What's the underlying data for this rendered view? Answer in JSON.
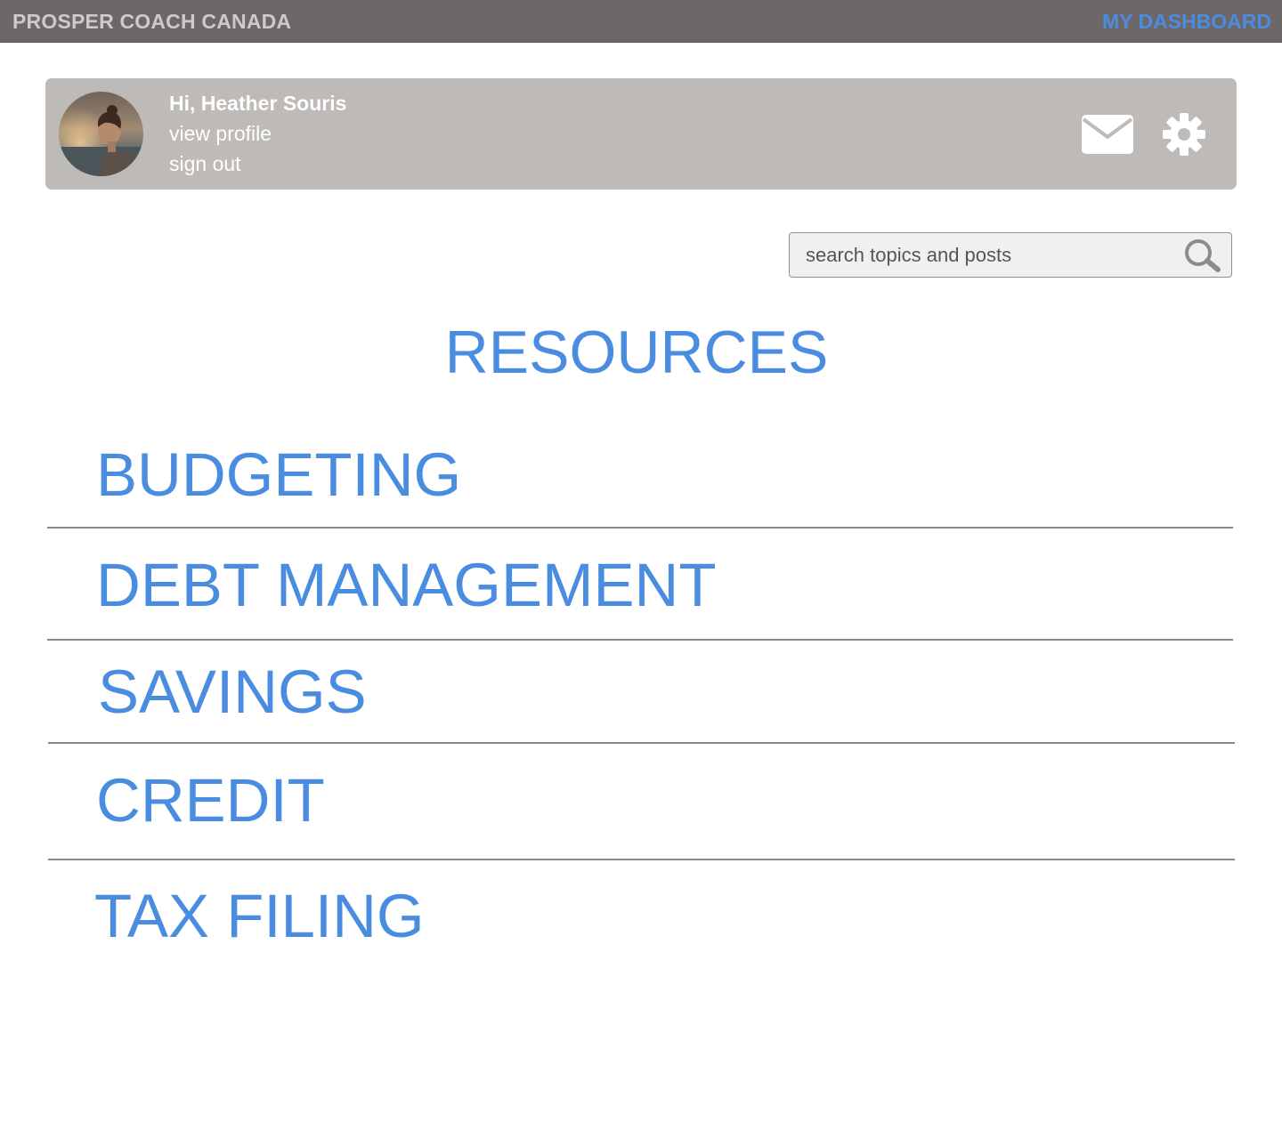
{
  "header": {
    "brand": "PROSPER COACH CANADA",
    "dashboard_link": "MY DASHBOARD"
  },
  "profile": {
    "greeting": "Hi, Heather Souris",
    "view_profile": "view profile",
    "sign_out": "sign out",
    "icons": [
      "avatar-photo",
      "mail-icon",
      "gear-icon"
    ]
  },
  "search": {
    "value": "",
    "placeholder": "search topics and posts",
    "icon": "search-icon"
  },
  "page": {
    "title": "RESOURCES"
  },
  "categories": [
    {
      "label": "BUDGETING"
    },
    {
      "label": "DEBT MANAGEMENT"
    },
    {
      "label": "SAVINGS"
    },
    {
      "label": "CREDIT"
    },
    {
      "label": "TAX FILING"
    }
  ],
  "colors": {
    "accent": "#4a8de0",
    "topbar": "#6e6767",
    "profile_card": "#bdbab7",
    "divider": "#8a8a8a"
  }
}
